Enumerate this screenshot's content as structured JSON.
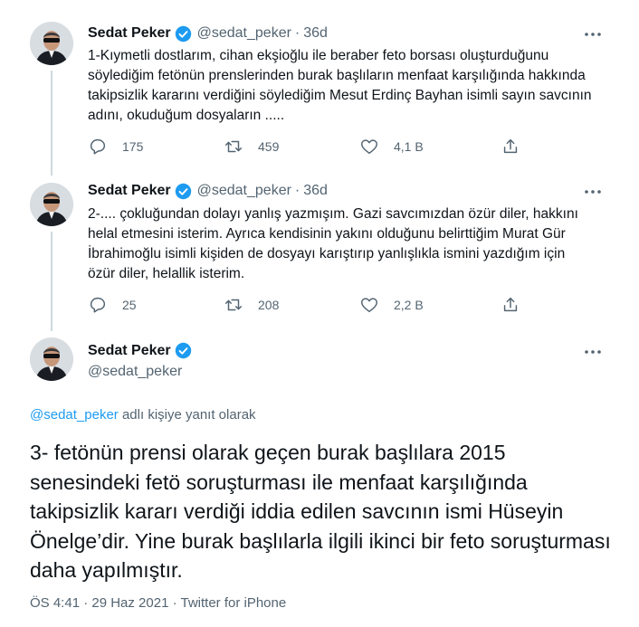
{
  "author": {
    "name": "Sedat Peker",
    "handle": "@sedat_peker",
    "verified_color": "#1d9bf0"
  },
  "icons": {
    "verified": "verified-badge-icon",
    "more": "more-options-icon",
    "reply": "reply-icon",
    "retweet": "retweet-icon",
    "like": "like-icon",
    "share": "share-icon"
  },
  "tweets": [
    {
      "age": "36d",
      "text": "1-Kıymetli dostlarım, cihan ekşioğlu ile beraber feto borsası oluşturduğunu söylediğim fetönün prenslerinden burak başlıların menfaat karşılığında hakkında takipsizlik kararını verdiğini söylediğim Mesut Erdinç Bayhan isimli sayın savcının adını, okuduğum dosyaların .....",
      "replies": "175",
      "retweets": "459",
      "likes": "4,1 B"
    },
    {
      "age": "36d",
      "text": "2-.... çokluğundan dolayı yanlış yazmışım. Gazi savcımızdan özür diler, hakkını helal etmesini isterim. Ayrıca kendisinin yakını olduğunu belirttiğim Murat Gür İbrahimoğlu isimli kişiden de dosyayı karıştırıp yanlışlıkla ismini yazdığım için özür diler, helallik isterim.",
      "replies": "25",
      "retweets": "208",
      "likes": "2,2 B"
    }
  ],
  "main_tweet": {
    "reply_mention": "@sedat_peker",
    "reply_suffix": " adlı kişiye yanıt olarak",
    "text": "3- fetönün prensi olarak geçen burak başlılara 2015 senesindeki fetö soruşturması ile menfaat karşılığında takipsizlik kararı verdiği iddia edilen savcının ismi Hüseyin Önelge’dir. Yine burak başlılarla ilgili ikinci bir feto soruşturması daha yapılmıştır.",
    "meta": "ÖS 4:41 · 29 Haz 2021 · Twitter for iPhone"
  }
}
